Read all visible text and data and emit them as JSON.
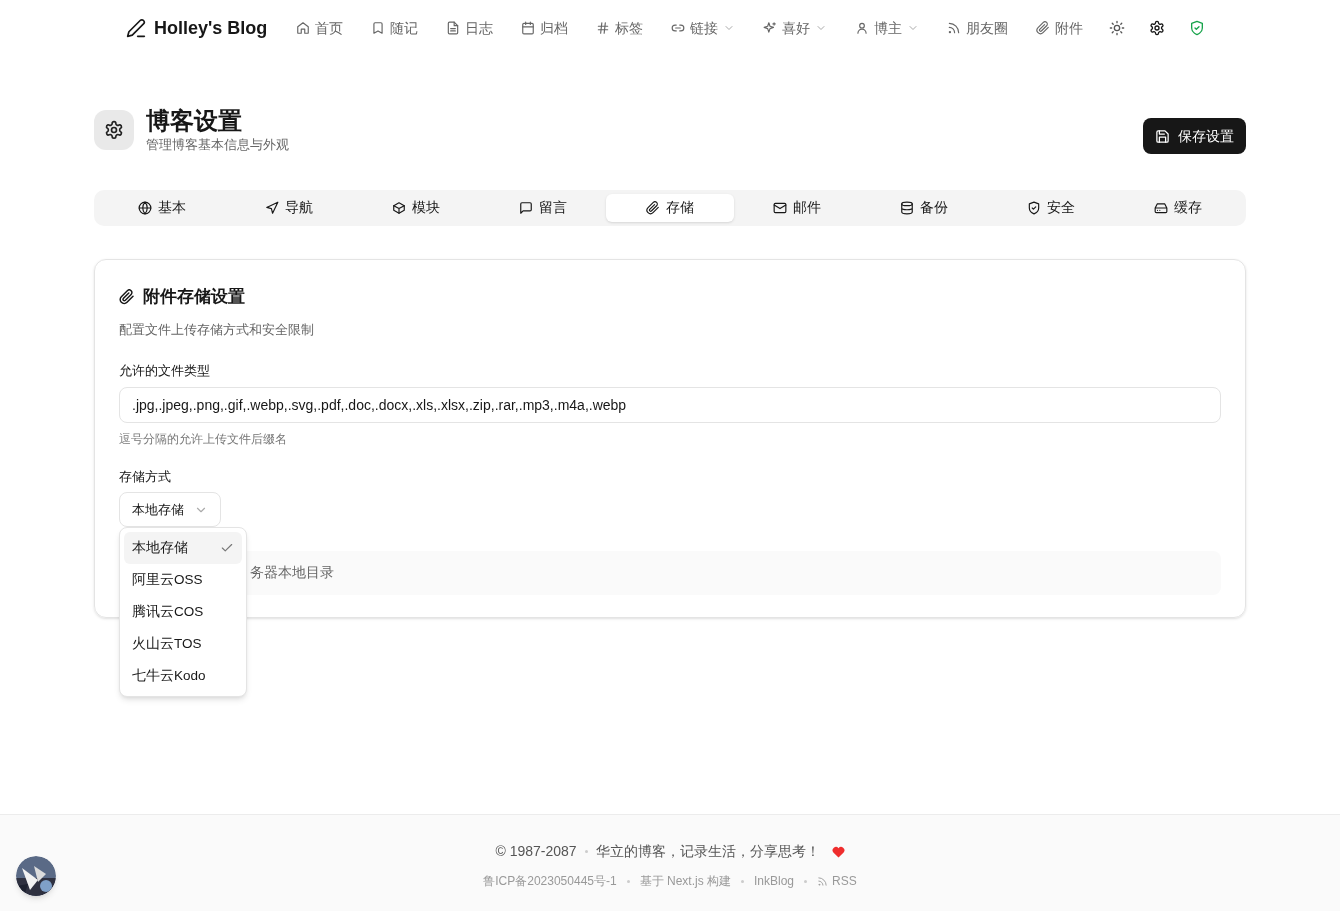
{
  "nav": {
    "logo": "Holley's Blog",
    "items": [
      {
        "label": "首页",
        "has_menu": false
      },
      {
        "label": "随记",
        "has_menu": false
      },
      {
        "label": "日志",
        "has_menu": false
      },
      {
        "label": "归档",
        "has_menu": false
      },
      {
        "label": "标签",
        "has_menu": false
      },
      {
        "label": "链接",
        "has_menu": true
      },
      {
        "label": "喜好",
        "has_menu": true
      },
      {
        "label": "博主",
        "has_menu": true
      },
      {
        "label": "朋友圈",
        "has_menu": false
      },
      {
        "label": "附件",
        "has_menu": false
      }
    ]
  },
  "header": {
    "title": "博客设置",
    "subtitle": "管理博客基本信息与外观",
    "save_button": "保存设置"
  },
  "tabs": [
    {
      "label": "基本",
      "selected": false
    },
    {
      "label": "导航",
      "selected": false
    },
    {
      "label": "模块",
      "selected": false
    },
    {
      "label": "留言",
      "selected": false
    },
    {
      "label": "存储",
      "selected": true
    },
    {
      "label": "邮件",
      "selected": false
    },
    {
      "label": "备份",
      "selected": false
    },
    {
      "label": "安全",
      "selected": false
    },
    {
      "label": "缓存",
      "selected": false
    }
  ],
  "card": {
    "title": "附件存储设置",
    "description": "配置文件上传存储方式和安全限制",
    "file_types": {
      "label": "允许的文件类型",
      "value": ".jpg,.jpeg,.png,.gif,.webp,.svg,.pdf,.doc,.docx,.xls,.xlsx,.zip,.rar,.mp3,.m4a,.webp",
      "hint": "逗号分隔的允许上传文件后缀名"
    },
    "storage": {
      "label": "存储方式",
      "value": "本地存储",
      "info": "务器本地目录",
      "options": [
        {
          "label": "本地存储",
          "selected": true
        },
        {
          "label": "阿里云OSS",
          "selected": false
        },
        {
          "label": "腾讯云COS",
          "selected": false
        },
        {
          "label": "火山云TOS",
          "selected": false
        },
        {
          "label": "七牛云Kodo",
          "selected": false
        }
      ]
    }
  },
  "footer": {
    "copyright": "© 1987-2087",
    "motto": "华立的博客，记录生活，分享思考！",
    "links": [
      "鲁ICP备2023050445号-1",
      "基于 Next.js 构建",
      "InkBlog",
      "RSS"
    ]
  }
}
